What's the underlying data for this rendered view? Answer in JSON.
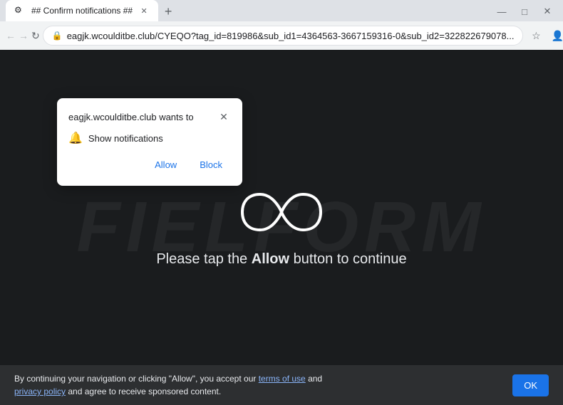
{
  "browser": {
    "tab": {
      "title": "## Confirm notifications ##",
      "favicon_symbol": "🔒"
    },
    "address_bar": {
      "url": "eagjk.wcoulditbe.club/CYEQO?tag_id=819986&sub_id1=4364563-3667159316-0&sub_id2=322822679078...",
      "lock_label": "🔒"
    },
    "nav": {
      "back_label": "←",
      "forward_label": "→",
      "reload_label": "↻",
      "new_tab_label": "+"
    },
    "titlebar": {
      "minimize": "—",
      "maximize": "□",
      "close": "✕"
    }
  },
  "notification_popup": {
    "title": "eagjk.wcoulditbe.club wants to",
    "close_label": "✕",
    "body_text": "Show notifications",
    "allow_label": "Allow",
    "block_label": "Block"
  },
  "page": {
    "main_text_prefix": "Please tap the ",
    "main_text_bold": "Allow",
    "main_text_suffix": " button to continue"
  },
  "consent_bar": {
    "text_part1": "By continuing your navigation or clicking \"Allow\", you accept our ",
    "terms_link": "terms of use",
    "text_part2": " and ",
    "privacy_link": "privacy policy",
    "text_part3": " and agree to receive sponsored content.",
    "ok_label": "OK"
  },
  "background": {
    "watermark": "fielform"
  }
}
